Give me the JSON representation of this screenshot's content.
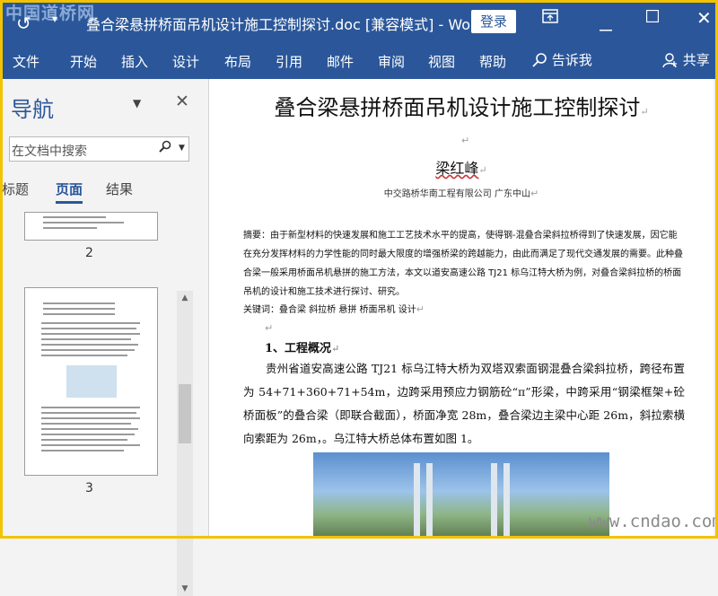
{
  "watermark_top": "中国道桥网",
  "watermark_bottom": "www.cndao.com",
  "titlebar": {
    "doc_title": "叠合梁悬拼桥面吊机设计施工控制探讨.doc [兼容模式]  -  Word",
    "login_label": "登录"
  },
  "ribbon": {
    "tabs": [
      "文件",
      "开始",
      "插入",
      "设计",
      "布局",
      "引用",
      "邮件",
      "审阅",
      "视图",
      "帮助"
    ],
    "tell_me": "告诉我",
    "share": "共享"
  },
  "nav": {
    "title": "导航",
    "search_placeholder": "在文档中搜索",
    "tabs": [
      "标题",
      "页面",
      "结果"
    ],
    "active_tab": "页面",
    "page_numbers": [
      "2",
      "3"
    ]
  },
  "document": {
    "title": "叠合梁悬拼桥面吊机设计施工控制探讨",
    "author": "梁红峰",
    "affiliation": "中交路桥华南工程有限公司  广东中山",
    "abstract": "摘要：由于新型材料的快速发展和施工工艺技术水平的提高，使得钢-混叠合梁斜拉桥得到了快速发展，因它能在充分发挥材料的力学性能的同时最大限度的增强桥梁的跨越能力，由此而满足了现代交通发展的需要。此种叠合梁一般采用桥面吊机悬拼的施工方法，本文以道安高速公路 TJ21 标乌江特大桥为例，对叠合梁斜拉桥的桥面吊机的设计和施工技术进行探讨、研究。",
    "keywords": "关键词：叠合梁  斜拉桥  悬拼  桥面吊机  设计",
    "section_heading": "1、工程概况",
    "body": "贵州省道安高速公路 TJ21 标乌江特大桥为双塔双索面钢混叠合梁斜拉桥，跨径布置为 54+71+360+71+54m，边跨采用预应力钢筋砼“π”形梁，中跨采用“钢梁框架+砼桥面板”的叠合梁（即联合截面），桥面净宽 28m，叠合梁边主梁中心距 26m，斜拉索横向索距为 26m，。乌江特大桥总体布置如图 1。"
  },
  "colors": {
    "ribbon_blue": "#2b579a",
    "frame_yellow": "#f2c300"
  }
}
